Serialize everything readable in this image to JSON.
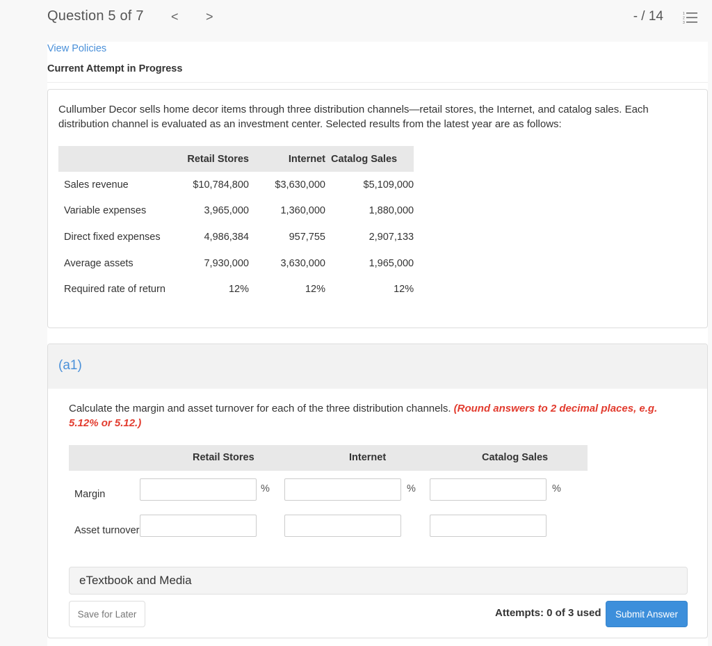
{
  "header": {
    "question_title": "Question 5 of 7",
    "prev_icon": "chevron-left-icon",
    "prev_glyph": "<",
    "next_icon": "chevron-right-icon",
    "next_glyph": ">",
    "score": "- / 14",
    "list_icon": "numbered-list-icon"
  },
  "links": {
    "view_policies": "View Policies"
  },
  "attempt_heading": "Current Attempt in Progress",
  "problem": {
    "text": "Cullumber Decor sells home decor items through three distribution channels—retail stores, the Internet, and catalog sales. Each distribution channel is evaluated as an investment center. Selected results from the latest year are as follows:",
    "table": {
      "columns": [
        "",
        "Retail Stores",
        "Internet",
        "Catalog Sales"
      ],
      "rows": [
        {
          "label": "Sales revenue",
          "values": [
            "$10,784,800",
            "$3,630,000",
            "$5,109,000"
          ]
        },
        {
          "label": "Variable expenses",
          "values": [
            "3,965,000",
            "1,360,000",
            "1,880,000"
          ]
        },
        {
          "label": "Direct fixed expenses",
          "values": [
            "4,986,384",
            "957,755",
            "2,907,133"
          ]
        },
        {
          "label": "Average assets",
          "values": [
            "7,930,000",
            "3,630,000",
            "1,965,000"
          ]
        },
        {
          "label": "Required rate of return",
          "values": [
            "12%",
            "12%",
            "12%"
          ]
        }
      ]
    }
  },
  "part": {
    "label": "(a1)",
    "instruction": "Calculate the margin and asset turnover for each of the three distribution channels. ",
    "hint": "(Round answers to 2 decimal places, e.g. 5.12% or 5.12.)",
    "columns": [
      "Retail Stores",
      "Internet",
      "Catalog Sales"
    ],
    "rows": [
      {
        "label": "Margin",
        "unit": "%",
        "values": [
          "",
          "",
          ""
        ]
      },
      {
        "label": "Asset turnover",
        "unit": "",
        "values": [
          "",
          "",
          ""
        ]
      }
    ]
  },
  "etextbook": "eTextbook and Media",
  "footer": {
    "save_label": "Save for Later",
    "attempts_text": "Attempts: 0 of 3 used",
    "submit_label": "Submit Answer"
  },
  "colors": {
    "link": "#4a90d9",
    "hint": "#e23b2e",
    "submit": "#3d8fdb"
  }
}
